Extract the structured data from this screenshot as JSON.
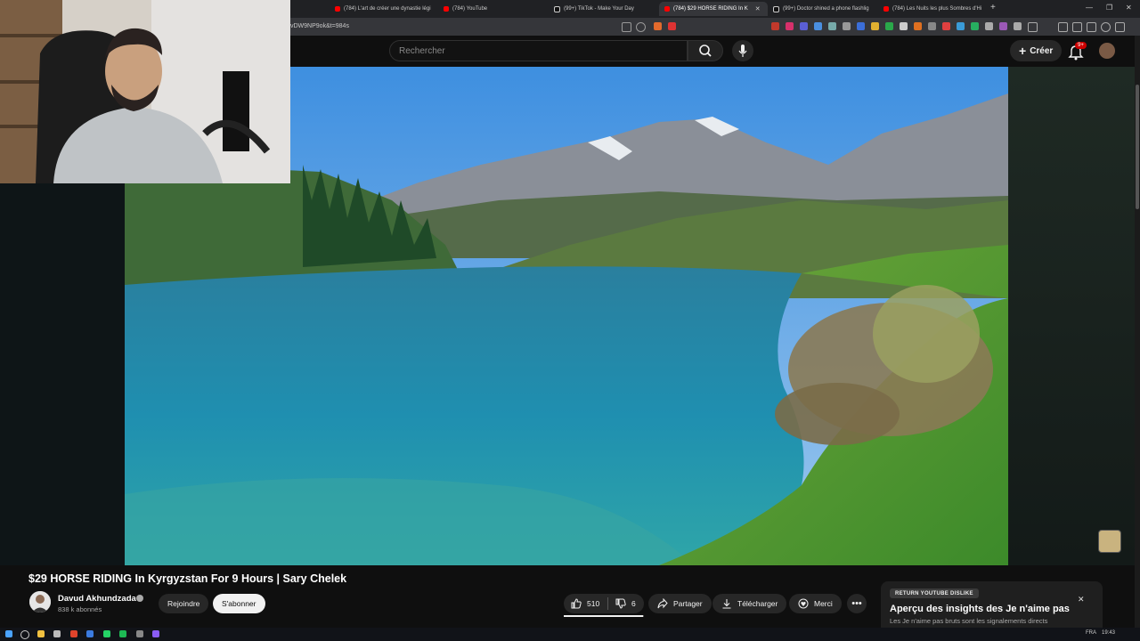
{
  "browser": {
    "tabs": [
      {
        "title": "(784) L'art de créer une dynastie légi",
        "active": false,
        "favicon": "youtube"
      },
      {
        "title": "(784) YouTube",
        "active": false,
        "favicon": "youtube"
      },
      {
        "title": "(99+) TikTok - Make Your Day",
        "active": false,
        "favicon": "tiktok"
      },
      {
        "title": "(784) $29 HORSE RIDING In K",
        "active": true,
        "favicon": "youtube"
      },
      {
        "title": "(99+) Doctor shined a phone flashlig",
        "active": false,
        "favicon": "tiktok"
      },
      {
        "title": "(784) Les Nuits les plus Sombres d'Hi",
        "active": false,
        "favicon": "youtube"
      }
    ],
    "url": "vDW9NP9ok&t=984s"
  },
  "header": {
    "search_placeholder": "Rechercher",
    "create_label": "Créer",
    "notification_badge": "9+"
  },
  "video": {
    "title": "$29 HORSE RIDING In Kyrgyzstan For 9 Hours | Sary Chelek",
    "channel_name": "Davud Akhundzada",
    "subscribers": "838 k abonnés",
    "join_label": "Rejoindre",
    "subscribe_label": "S'abonner",
    "likes": "510",
    "dislikes": "6",
    "share_label": "Partager",
    "download_label": "Télécharger",
    "thanks_label": "Merci",
    "like_ratio_percent": 98.8
  },
  "ryd_panel": {
    "tag": "RETURN YOUTUBE DISLIKE",
    "title": "Aperçu des insights des Je n'aime pas",
    "text": "Les Je n'aime pas bruts sont les signalements directs"
  },
  "taskbar": {
    "language": "FRA",
    "time": "19:43"
  },
  "colors": {
    "accent_red": "#ff0000",
    "background": "#0f0f0f",
    "water": "#1f8fae",
    "sky": "#4a9be0"
  }
}
